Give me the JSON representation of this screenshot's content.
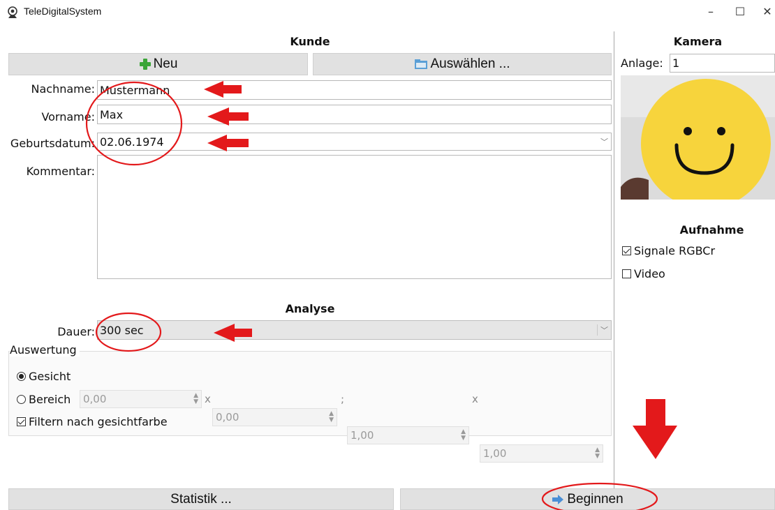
{
  "window": {
    "title": "TeleDigitalSystem",
    "minimize": "–",
    "maximize": "☐",
    "close": "✕"
  },
  "kunde": {
    "title": "Kunde",
    "new_label": "Neu",
    "select_label": "Auswählen ...",
    "nachname_label": "Nachname:",
    "nachname_value": "Mustermann",
    "vorname_label": "Vorname:",
    "vorname_value": "Max",
    "geburtsdatum_label": "Geburtsdatum:",
    "geburtsdatum_value": "02.06.1974",
    "kommentar_label": "Kommentar:",
    "kommentar_value": ""
  },
  "analyse": {
    "title": "Analyse",
    "dauer_label": "Dauer:",
    "dauer_value": "300 sec",
    "auswertung": {
      "title": "Auswertung",
      "gesicht_label": "Gesicht",
      "gesicht_selected": true,
      "bereich_label": "Bereich",
      "bereich_selected": false,
      "bereich_values": [
        "0,00",
        "0,00",
        "1,00",
        "1,00"
      ],
      "sep_x": "x",
      "sep_semicolon": ";",
      "filter_label": "Filtern nach gesichtfarbe",
      "filter_checked": true
    }
  },
  "kamera": {
    "title": "Kamera",
    "anlage_label": "Anlage:",
    "anlage_value": "1"
  },
  "aufnahme": {
    "title": "Aufnahme",
    "signale_label": "Signale RGBCr",
    "signale_checked": true,
    "video_label": "Video",
    "video_checked": false
  },
  "footer": {
    "statistik_label": "Statistik ...",
    "beginnen_label": "Beginnen"
  },
  "colors": {
    "annotation_red": "#e3191b",
    "smiley_yellow": "#f7d43c",
    "button_gray": "#e1e1e1"
  },
  "icons": {
    "window": "webcam-icon",
    "new": "green-plus-icon",
    "select": "folder-icon",
    "start": "blue-arrow-right-icon"
  }
}
